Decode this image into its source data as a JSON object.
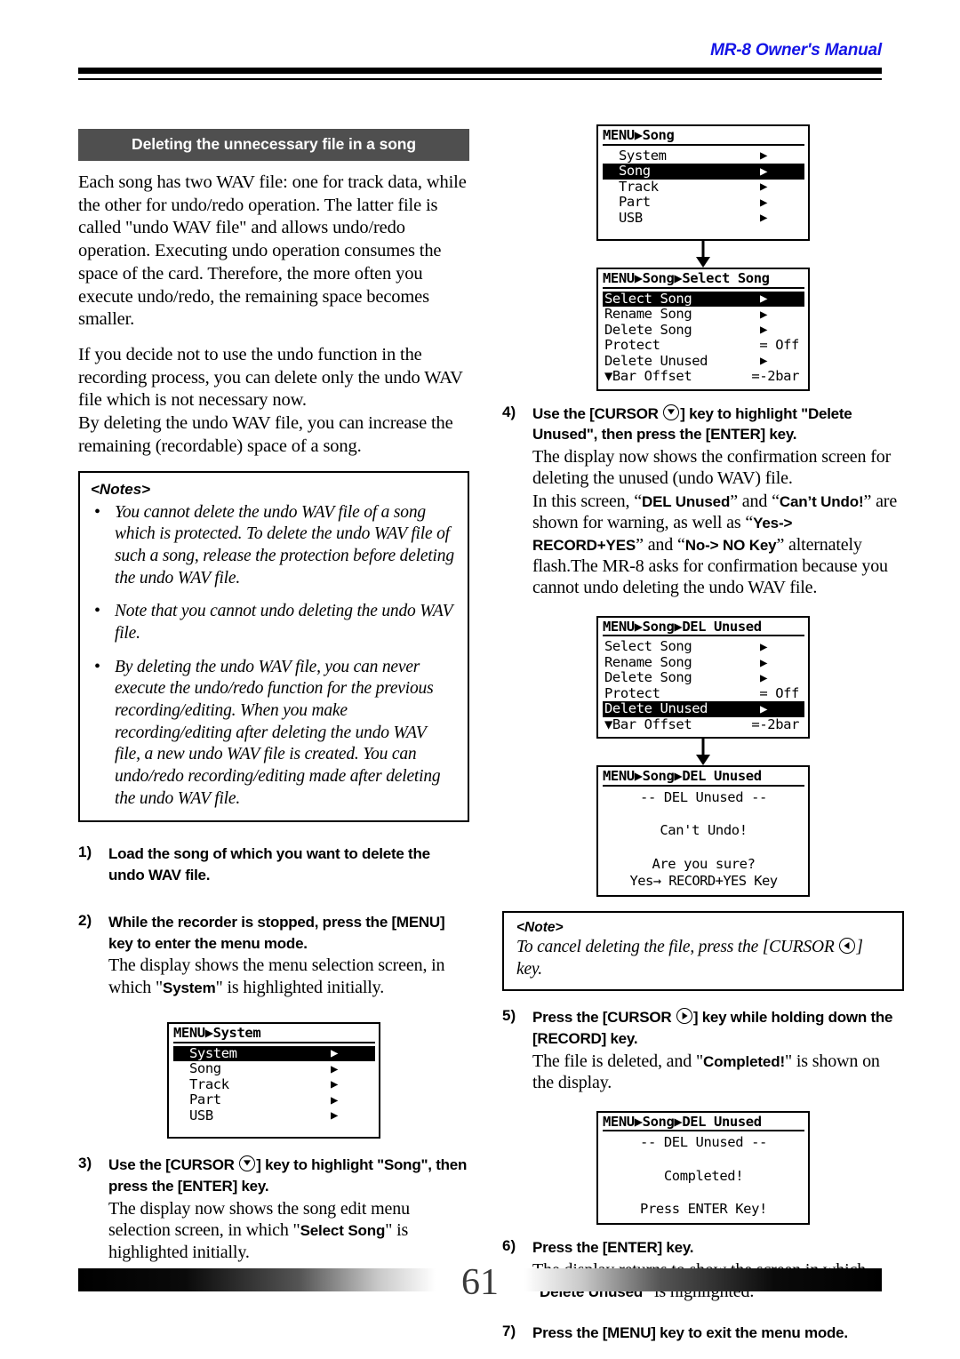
{
  "header": {
    "title": "MR-8 Owner's Manual"
  },
  "footer": {
    "page_number": "61"
  },
  "left_column": {
    "section_heading": "Deleting the unnecessary file in a song",
    "paragraph_1": "Each song has two WAV file: one for track data, while the other for undo/redo operation. The latter file is called \"undo WAV file\" and allows undo/redo operation. Executing undo operation consumes the space of the card. Therefore, the more often you execute undo/redo, the remaining space becomes smaller.",
    "paragraph_2": "If you decide not to use the undo function in the recording process, you can delete only the undo WAV file which is not necessary now.",
    "paragraph_3": "By deleting the undo WAV file, you can increase the remaining (recordable) space of a song.",
    "notes": {
      "title": "<Notes>",
      "items": [
        "You cannot delete the undo WAV file of a song which is protected. To delete the undo WAV file of such a song, release the protection before deleting the undo WAV file.",
        "Note that you cannot undo deleting the undo WAV file.",
        "By deleting the undo WAV file, you can never execute the undo/redo function for the previous recording/editing. When you make recording/editing after deleting the undo WAV file, a new undo WAV file is created. You can undo/redo recording/editing made after deleting the undo WAV file."
      ]
    },
    "step1": {
      "number": "1)",
      "heading": "Load the song of which you want to delete the undo WAV file."
    },
    "step2": {
      "number": "2)",
      "heading": "While the recorder is stopped, press the [MENU] key to enter the menu mode.",
      "body_a": "The display shows the menu selection screen, in which \"",
      "body_bold": "System",
      "body_b": "\" is highlighted initially."
    },
    "step3": {
      "number": "3)",
      "heading_a": "Use the [CURSOR ",
      "heading_b": "] key to highlight \"Song\", then press the [ENTER] key.",
      "body_a": "The display now shows the song edit menu selection screen, in which \"",
      "body_bold": "Select Song",
      "body_b": "\" is highlighted initially."
    },
    "lcd_menu_system": {
      "title": "MENU▶System",
      "rows": [
        {
          "label": "System",
          "arrow": "▶",
          "selected": true
        },
        {
          "label": "Song",
          "arrow": "▶",
          "selected": false
        },
        {
          "label": "Track",
          "arrow": "▶",
          "selected": false
        },
        {
          "label": "Part",
          "arrow": "▶",
          "selected": false
        },
        {
          "label": "USB",
          "arrow": "▶",
          "selected": false
        }
      ]
    }
  },
  "right_column": {
    "lcd_menu_song": {
      "title": "MENU▶Song",
      "rows": [
        {
          "label": "System",
          "arrow": "▶",
          "selected": false
        },
        {
          "label": "Song",
          "arrow": "▶",
          "selected": true
        },
        {
          "label": "Track",
          "arrow": "▶",
          "selected": false
        },
        {
          "label": "Part",
          "arrow": "▶",
          "selected": false
        },
        {
          "label": "USB",
          "arrow": "▶",
          "selected": false
        }
      ]
    },
    "lcd_select_song": {
      "title": "MENU▶Song▶Select Song",
      "rows": [
        {
          "label": "Select Song",
          "value": "▶",
          "selected": true
        },
        {
          "label": "Rename Song",
          "value": "▶",
          "selected": false
        },
        {
          "label": "Delete Song",
          "value": "▶",
          "selected": false
        },
        {
          "label": "Protect",
          "value": "= Off",
          "selected": false
        },
        {
          "label": "Delete Unused",
          "value": "▶",
          "selected": false
        },
        {
          "label": "▼Bar Offset",
          "value": "=-2bar",
          "selected": false
        }
      ]
    },
    "lcd_del_unused_menu": {
      "title": "MENU▶Song▶DEL Unused",
      "rows": [
        {
          "label": "Select Song",
          "value": "▶",
          "selected": false
        },
        {
          "label": "Rename Song",
          "value": "▶",
          "selected": false
        },
        {
          "label": "Delete Song",
          "value": "▶",
          "selected": false
        },
        {
          "label": "Protect",
          "value": "= Off",
          "selected": false
        },
        {
          "label": "Delete Unused",
          "value": "▶",
          "selected": true
        },
        {
          "label": "▼Bar Offset",
          "value": "=-2bar",
          "selected": false
        }
      ]
    },
    "lcd_confirm": {
      "title": "MENU▶Song▶DEL Unused",
      "line1": "-- DEL Unused --",
      "line2": "Can't Undo!",
      "line3": "Are you sure?",
      "line4": "Yes→ RECORD+YES Key"
    },
    "lcd_completed": {
      "title": "MENU▶Song▶DEL Unused",
      "line1": "-- DEL Unused --",
      "line2": "Completed!",
      "line3": "Press ENTER Key!"
    },
    "step4": {
      "number": "4)",
      "heading_a": "Use the [CURSOR ",
      "heading_b": "] key to highlight \"Delete Unused\", then press the [ENTER] key.",
      "body_1": "The display now shows the confirmation screen for deleting the unused (undo WAV) file.",
      "body_2_a": "In this screen, “",
      "body_2_b1": "DEL Unused",
      "body_2_c": "” and “",
      "body_2_b2": "Can’t Undo!",
      "body_2_d": "” are shown for warning, as well as “",
      "body_2_b3": "Yes-> RECORD+YES",
      "body_2_e": "” and “",
      "body_2_b4": "No-> NO Key",
      "body_2_f": "” alternately flash.The MR-8 asks for confirmation because you cannot undo deleting the undo WAV file."
    },
    "note": {
      "title": "<Note>",
      "body_a": "To cancel deleting the file, press the [CURSOR ",
      "body_b": "] key."
    },
    "step5": {
      "number": "5)",
      "heading_a": "Press the [CURSOR ",
      "heading_b": "] key while holding down the [RECORD] key.",
      "body_a": "The file is deleted, and \"",
      "body_bold": "Completed!",
      "body_b": "\" is shown on the display."
    },
    "step6": {
      "number": "6)",
      "heading": "Press the [ENTER] key.",
      "body_a": "The display returns to show the screen in which \"",
      "body_bold": "Delete Unused",
      "body_b": "\" is highlighted."
    },
    "step7": {
      "number": "7)",
      "heading": "Press the [MENU] key to exit the menu mode."
    }
  }
}
